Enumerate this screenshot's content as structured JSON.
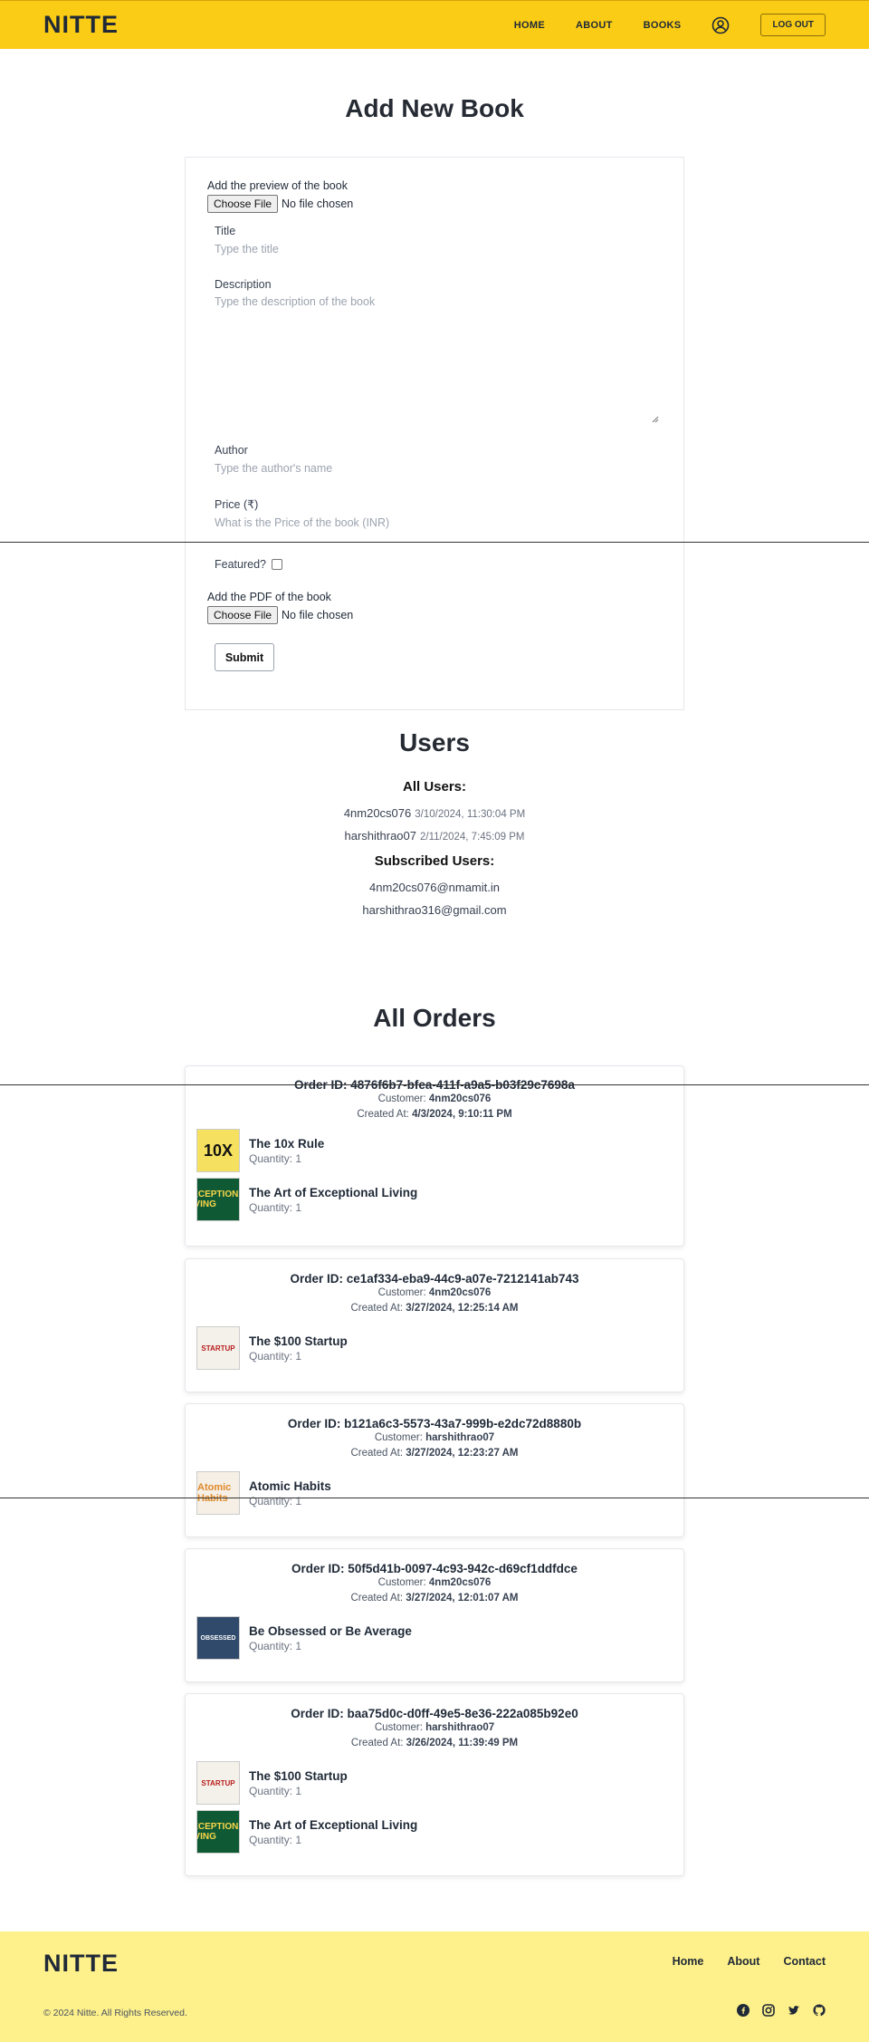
{
  "header": {
    "brand": "NITTE",
    "nav": {
      "home": "HOME",
      "about": "ABOUT",
      "books": "BOOKS"
    },
    "logout": "LOG OUT"
  },
  "add_book": {
    "title": "Add New Book",
    "preview_label": "Add the preview of the book",
    "choose_file": "Choose File",
    "no_file": "No file chosen",
    "title_label": "Title",
    "title_placeholder": "Type the title",
    "description_label": "Description",
    "description_placeholder": "Type the description of the book",
    "author_label": "Author",
    "author_placeholder": "Type the author's name",
    "price_label": "Price (₹)",
    "price_placeholder": "What is the Price of the book (INR)",
    "featured_label": "Featured?",
    "pdf_label": "Add the PDF of the book",
    "submit": "Submit"
  },
  "users": {
    "title": "Users",
    "all_users_heading": "All Users:",
    "all_users": [
      {
        "name": "4nm20cs076",
        "timestamp": "3/10/2024, 11:30:04 PM"
      },
      {
        "name": "harshithrao07",
        "timestamp": "2/11/2024, 7:45:09 PM"
      }
    ],
    "subscribed_heading": "Subscribed Users:",
    "subscribed": [
      "4nm20cs076@nmamit.in",
      "harshithrao316@gmail.com"
    ]
  },
  "orders": {
    "title": "All Orders",
    "customer_label": "Customer:",
    "created_label": "Created At:",
    "quantity_label": "Quantity:",
    "list": [
      {
        "id": "Order ID: 4876f6b7-bfea-411f-a9a5-b03f29c7698a",
        "customer": "4nm20cs076",
        "created": "4/3/2024, 9:10:11 PM",
        "items": [
          {
            "name": "The 10x Rule",
            "quantity": "1",
            "cover": "10X"
          },
          {
            "name": "The Art of Exceptional Living",
            "quantity": "1",
            "cover": "EXCEPTIONAL LIVING"
          }
        ]
      },
      {
        "id": "Order ID: ce1af334-eba9-44c9-a07e-7212141ab743",
        "customer": "4nm20cs076",
        "created": "3/27/2024, 12:25:14 AM",
        "items": [
          {
            "name": "The $100 Startup",
            "quantity": "1",
            "cover": "STARTUP"
          }
        ]
      },
      {
        "id": "Order ID: b121a6c3-5573-43a7-999b-e2dc72d8880b",
        "customer": "harshithrao07",
        "created": "3/27/2024, 12:23:27 AM",
        "items": [
          {
            "name": "Atomic Habits",
            "quantity": "1",
            "cover": "Atomic Habits"
          }
        ]
      },
      {
        "id": "Order ID: 50f5d41b-0097-4c93-942c-d69cf1ddfdce",
        "customer": "4nm20cs076",
        "created": "3/27/2024, 12:01:07 AM",
        "items": [
          {
            "name": "Be Obsessed or Be Average",
            "quantity": "1",
            "cover": "OBSESSED"
          }
        ]
      },
      {
        "id": "Order ID: baa75d0c-d0ff-49e5-8e36-222a085b92e0",
        "customer": "harshithrao07",
        "created": "3/26/2024, 11:39:49 PM",
        "items": [
          {
            "name": "The $100 Startup",
            "quantity": "1",
            "cover": "STARTUP"
          },
          {
            "name": "The Art of Exceptional Living",
            "quantity": "1",
            "cover": "EXCEPTIONAL LIVING"
          }
        ]
      }
    ]
  },
  "footer": {
    "brand": "NITTE",
    "links": {
      "home": "Home",
      "about": "About",
      "contact": "Contact"
    },
    "copyright": "© 2024 Nitte. All Rights Reserved.",
    "socials": [
      "facebook-icon",
      "instagram-icon",
      "twitter-icon",
      "github-icon"
    ]
  },
  "colors": {
    "header": "#facc15",
    "footer": "#fef08a"
  }
}
